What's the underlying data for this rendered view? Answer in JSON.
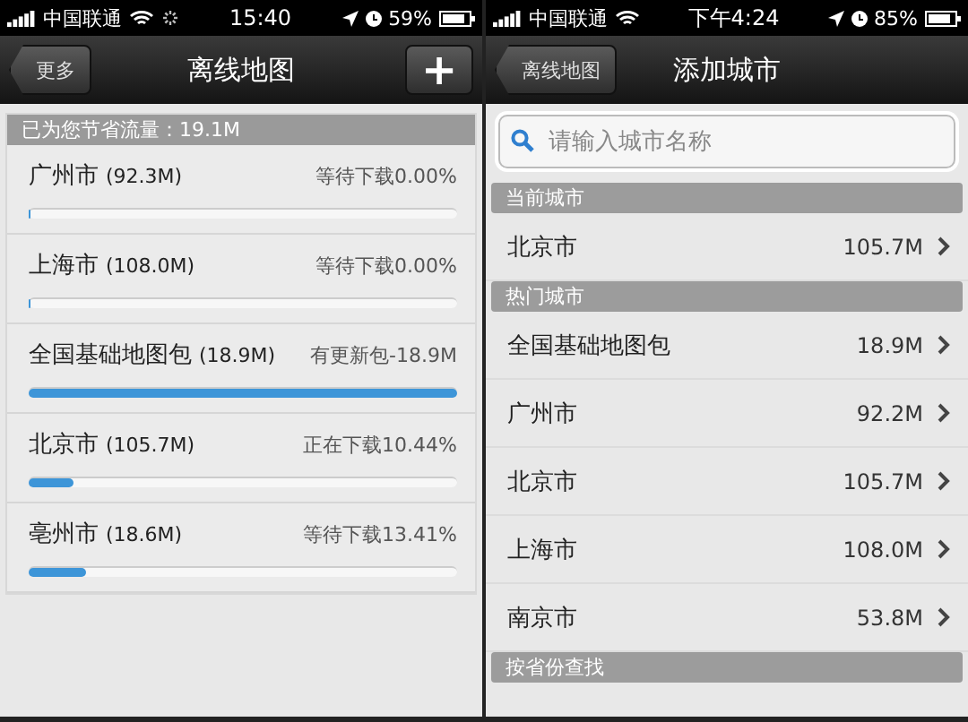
{
  "screens": [
    {
      "status_bar": {
        "carrier": "中国联通",
        "time": "15:40",
        "battery": "59%",
        "loading": true
      },
      "nav": {
        "back": "更多",
        "title": "离线地图",
        "add_button": "+"
      },
      "banner": "已为您节省流量：19.1M",
      "downloads": [
        {
          "name": "广州市",
          "size": "(92.3M)",
          "status": "等待下载0.00%",
          "level": 0
        },
        {
          "name": "上海市",
          "size": "(108.0M)",
          "status": "等待下载0.00%",
          "level": 0
        },
        {
          "name": "全国基础地图包",
          "size": "(18.9M)",
          "status": "有更新包-18.9M",
          "level": 1
        },
        {
          "name": "北京市",
          "size": "(105.7M)",
          "status": "正在下载10.44%",
          "level": 0.1044
        },
        {
          "name": "亳州市",
          "size": "(18.6M)",
          "status": "等待下载13.41%",
          "level": 0.1341
        }
      ]
    },
    {
      "status_bar": {
        "carrier": "中国联通",
        "time": "下午4:24",
        "battery": "85%",
        "loading": false
      },
      "nav": {
        "back": "离线地图",
        "title": "添加城市"
      },
      "search": {
        "placeholder": "请输入城市名称"
      },
      "sections": [
        {
          "header": "当前城市",
          "rows": [
            {
              "name": "北京市",
              "size": "105.7M"
            }
          ]
        },
        {
          "header": "热门城市",
          "rows": [
            {
              "name": "全国基础地图包",
              "size": "18.9M"
            },
            {
              "name": "广州市",
              "size": "92.2M"
            },
            {
              "name": "北京市",
              "size": "105.7M"
            },
            {
              "name": "上海市",
              "size": "108.0M"
            },
            {
              "name": "南京市",
              "size": "53.8M"
            }
          ]
        },
        {
          "header": "按省份查找"
        }
      ]
    }
  ]
}
